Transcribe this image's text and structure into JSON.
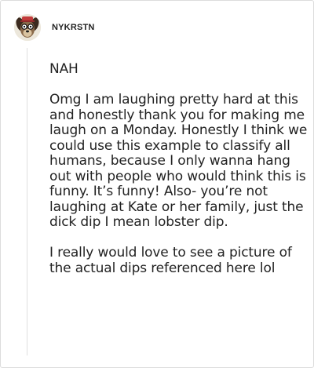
{
  "post": {
    "username": "NYKRSTN",
    "avatar_icon": "dog-avatar-icon",
    "heading": "NAH",
    "paragraphs": [
      "Omg I am laughing pretty hard at this and honestly thank you for making me laugh on a Monday. Honestly I think we could use this example to classify all humans, because I only wanna hang out with people who would think this is funny. It’s funny! Also- you’re not laughing at Kate or her family, just the dick dip I mean lobster dip.",
      "I really would love to see a picture of the actual dips referenced here lol"
    ]
  },
  "colors": {
    "text": "#222222",
    "border": "#dcdcdc",
    "thread_line": "#dfdfdf"
  }
}
